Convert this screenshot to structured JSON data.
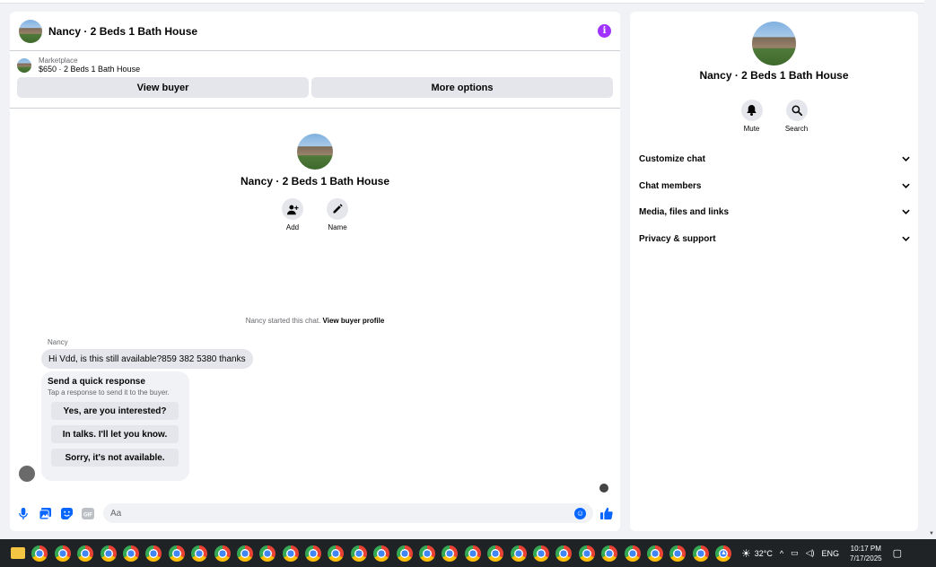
{
  "chat": {
    "title": "Nancy · 2 Beds 1 Bath House",
    "listing_label": "Marketplace",
    "listing_price": "$650 · 2 Beds 1 Bath House",
    "view_buyer": "View buyer",
    "more_options": "More options",
    "center_name": "Nancy · 2 Beds 1 Bath House",
    "add_label": "Add",
    "name_label": "Name",
    "started_text": "Nancy started this chat. ",
    "started_link": "View buyer profile",
    "sender": "Nancy",
    "message": "Hi Vdd, is this still available?859 382 5380 thanks",
    "quick_title": "Send a quick response",
    "quick_sub": "Tap a response to send it to the buyer.",
    "quick_responses": [
      "Yes, are you interested?",
      "In talks. I'll let you know.",
      "Sorry, it's not available."
    ],
    "input_placeholder": "Aa"
  },
  "panel": {
    "name": "Nancy · 2 Beds 1 Bath House",
    "mute": "Mute",
    "search": "Search",
    "sections": [
      "Customize chat",
      "Chat members",
      "Media, files and links",
      "Privacy & support"
    ]
  },
  "taskbar": {
    "temperature": "32°C",
    "language": "ENG",
    "time": "10:17 PM",
    "date": "7/17/2025"
  },
  "colors": {
    "accent": "#0866ff",
    "info": "#a033ff",
    "bubble": "#e4e6eb"
  }
}
